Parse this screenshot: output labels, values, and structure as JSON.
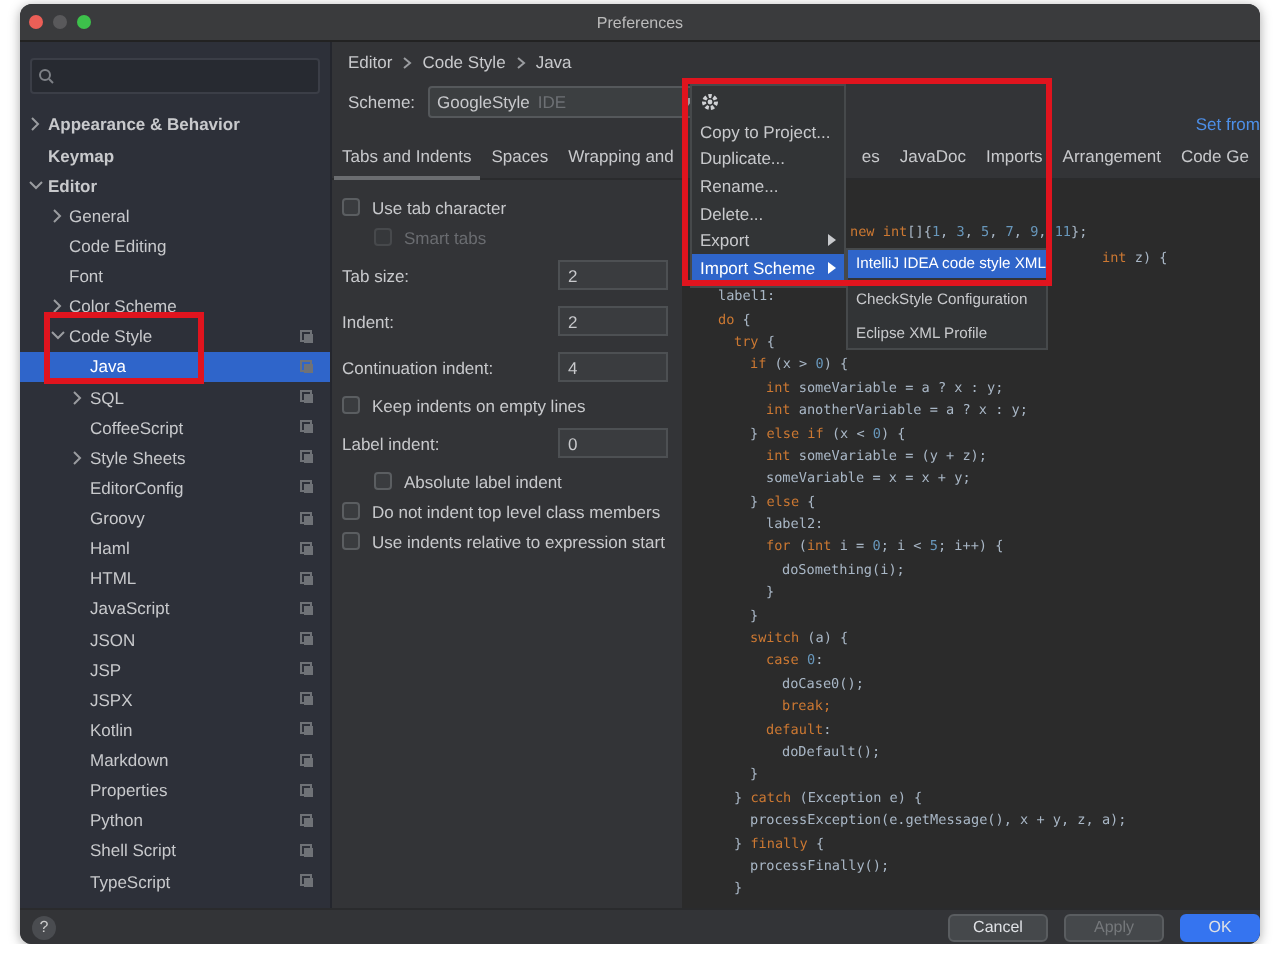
{
  "window": {
    "title": "Preferences"
  },
  "sidebar": {
    "items": [
      {
        "label": "Appearance & Behavior",
        "expanded": false,
        "selected": false,
        "scoped": false
      },
      {
        "label": "Keymap",
        "selected": false,
        "scoped": false
      },
      {
        "label": "Editor",
        "expanded": true,
        "selected": false,
        "scoped": false,
        "children": [
          {
            "label": "General",
            "expanded": false,
            "selected": false,
            "scoped": false
          },
          {
            "label": "Code Editing",
            "selected": false,
            "scoped": false
          },
          {
            "label": "Font",
            "selected": false,
            "scoped": false
          },
          {
            "label": "Color Scheme",
            "expanded": false,
            "selected": false,
            "scoped": false
          },
          {
            "label": "Code Style",
            "expanded": true,
            "selected": false,
            "scoped": true,
            "highlighted": true,
            "children": [
              {
                "label": "Java",
                "selected": true,
                "scoped": true
              },
              {
                "label": "SQL",
                "expanded": false,
                "selected": false,
                "scoped": true
              },
              {
                "label": "CoffeeScript",
                "selected": false,
                "scoped": true
              },
              {
                "label": "Style Sheets",
                "expanded": false,
                "selected": false,
                "scoped": true
              },
              {
                "label": "EditorConfig",
                "selected": false,
                "scoped": true
              },
              {
                "label": "Groovy",
                "selected": false,
                "scoped": true
              },
              {
                "label": "Haml",
                "selected": false,
                "scoped": true
              },
              {
                "label": "HTML",
                "selected": false,
                "scoped": true
              },
              {
                "label": "JavaScript",
                "selected": false,
                "scoped": true
              },
              {
                "label": "JSON",
                "selected": false,
                "scoped": true
              },
              {
                "label": "JSP",
                "selected": false,
                "scoped": true
              },
              {
                "label": "JSPX",
                "selected": false,
                "scoped": true
              },
              {
                "label": "Kotlin",
                "selected": false,
                "scoped": true
              },
              {
                "label": "Markdown",
                "selected": false,
                "scoped": true
              },
              {
                "label": "Properties",
                "selected": false,
                "scoped": true
              },
              {
                "label": "Python",
                "selected": false,
                "scoped": true
              },
              {
                "label": "Shell Script",
                "selected": false,
                "scoped": true
              },
              {
                "label": "TypeScript",
                "selected": false,
                "scoped": true
              }
            ]
          }
        ]
      }
    ]
  },
  "breadcrumb": [
    "Editor",
    "Code Style",
    "Java"
  ],
  "scheme": {
    "label": "Scheme:",
    "value": "GoogleStyle",
    "scope": "IDE"
  },
  "set_from_link": "Set from",
  "tabs": [
    {
      "label": "Tabs and Indents",
      "selected": true
    },
    {
      "label": "Spaces",
      "selected": false
    },
    {
      "label": "Wrapping and",
      "selected": false
    },
    {
      "label": "es",
      "selected": false
    },
    {
      "label": "JavaDoc",
      "selected": false
    },
    {
      "label": "Imports",
      "selected": false
    },
    {
      "label": "Arrangement",
      "selected": false
    },
    {
      "label": "Code Ge",
      "selected": false
    }
  ],
  "options": [
    {
      "kind": "checkbox",
      "label": "Use tab character",
      "checked": false,
      "disabled": false,
      "children": [
        {
          "kind": "checkbox",
          "label": "Smart tabs",
          "checked": false,
          "disabled": true
        }
      ]
    },
    {
      "kind": "number",
      "label": "Tab size:",
      "value": "2"
    },
    {
      "kind": "number",
      "label": "Indent:",
      "value": "2"
    },
    {
      "kind": "number",
      "label": "Continuation indent:",
      "value": "4"
    },
    {
      "kind": "checkbox",
      "label": "Keep indents on empty lines",
      "checked": false,
      "disabled": false
    },
    {
      "kind": "number",
      "label": "Label indent:",
      "value": "0",
      "children": [
        {
          "kind": "checkbox",
          "label": "Absolute label indent",
          "checked": false,
          "disabled": false
        }
      ]
    },
    {
      "kind": "checkbox",
      "label": "Do not indent top level class members",
      "checked": false,
      "disabled": false
    },
    {
      "kind": "checkbox",
      "label": "Use indents relative to expression start",
      "checked": false,
      "disabled": false
    }
  ],
  "code": {
    "covered_lines": [
      {
        "tokens": [
          {
            "kind": "keyword",
            "text": "new "
          },
          {
            "kind": "keyword",
            "text": "int"
          },
          {
            "kind": "plain",
            "text": "[]{"
          },
          {
            "kind": "number",
            "text": "1"
          },
          {
            "kind": "plain",
            "text": ", "
          },
          {
            "kind": "number",
            "text": "3"
          },
          {
            "kind": "plain",
            "text": ", "
          },
          {
            "kind": "number",
            "text": "5"
          },
          {
            "kind": "plain",
            "text": ", "
          },
          {
            "kind": "number",
            "text": "7"
          },
          {
            "kind": "plain",
            "text": ", "
          },
          {
            "kind": "number",
            "text": "9"
          },
          {
            "kind": "plain",
            "text": ", "
          },
          {
            "kind": "number",
            "text": "11"
          },
          {
            "kind": "plain",
            "text": "};"
          }
        ]
      },
      {
        "tokens": [
          {
            "kind": "keyword",
            "text": "int "
          },
          {
            "kind": "plain",
            "text": "z) {"
          }
        ]
      }
    ],
    "lines": [
      {
        "tokens": [
          {
            "kind": "plain",
            "text": "label1:"
          }
        ]
      },
      {
        "tokens": [
          {
            "kind": "keyword",
            "text": "do "
          },
          {
            "kind": "plain",
            "text": "{"
          }
        ],
        "children": [
          {
            "tokens": [
              {
                "kind": "keyword",
                "text": "try "
              },
              {
                "kind": "plain",
                "text": "{"
              }
            ],
            "children": [
              {
                "tokens": [
                  {
                    "kind": "keyword",
                    "text": "if "
                  },
                  {
                    "kind": "plain",
                    "text": "(x > "
                  },
                  {
                    "kind": "number",
                    "text": "0"
                  },
                  {
                    "kind": "plain",
                    "text": ") {"
                  }
                ],
                "children": [
                  {
                    "tokens": [
                      {
                        "kind": "keyword",
                        "text": "int "
                      },
                      {
                        "kind": "plain",
                        "text": "someVariable = a ? x : y;"
                      }
                    ]
                  },
                  {
                    "tokens": [
                      {
                        "kind": "keyword",
                        "text": "int "
                      },
                      {
                        "kind": "plain",
                        "text": "anotherVariable = a ? x : y;"
                      }
                    ]
                  }
                ]
              },
              {
                "tokens": [
                  {
                    "kind": "plain",
                    "text": "} "
                  },
                  {
                    "kind": "keyword",
                    "text": "else if "
                  },
                  {
                    "kind": "plain",
                    "text": "(x < "
                  },
                  {
                    "kind": "number",
                    "text": "0"
                  },
                  {
                    "kind": "plain",
                    "text": ") {"
                  }
                ],
                "children": [
                  {
                    "tokens": [
                      {
                        "kind": "keyword",
                        "text": "int "
                      },
                      {
                        "kind": "plain",
                        "text": "someVariable = (y + z);"
                      }
                    ]
                  },
                  {
                    "tokens": [
                      {
                        "kind": "plain",
                        "text": "someVariable = x = x + y;"
                      }
                    ]
                  }
                ]
              },
              {
                "tokens": [
                  {
                    "kind": "plain",
                    "text": "} "
                  },
                  {
                    "kind": "keyword",
                    "text": "else "
                  },
                  {
                    "kind": "plain",
                    "text": "{"
                  }
                ],
                "children": [
                  {
                    "tokens": [
                      {
                        "kind": "plain",
                        "text": "label2:"
                      }
                    ]
                  },
                  {
                    "tokens": [
                      {
                        "kind": "keyword",
                        "text": "for "
                      },
                      {
                        "kind": "plain",
                        "text": "("
                      },
                      {
                        "kind": "keyword",
                        "text": "int "
                      },
                      {
                        "kind": "plain",
                        "text": "i = "
                      },
                      {
                        "kind": "number",
                        "text": "0"
                      },
                      {
                        "kind": "plain",
                        "text": "; i < "
                      },
                      {
                        "kind": "number",
                        "text": "5"
                      },
                      {
                        "kind": "plain",
                        "text": "; i++) {"
                      }
                    ],
                    "children": [
                      {
                        "tokens": [
                          {
                            "kind": "plain",
                            "text": "doSomething(i);"
                          }
                        ]
                      }
                    ]
                  },
                  {
                    "tokens": [
                      {
                        "kind": "plain",
                        "text": "}"
                      }
                    ]
                  }
                ]
              },
              {
                "tokens": [
                  {
                    "kind": "plain",
                    "text": "}"
                  }
                ]
              },
              {
                "tokens": [
                  {
                    "kind": "keyword",
                    "text": "switch "
                  },
                  {
                    "kind": "plain",
                    "text": "(a) {"
                  }
                ],
                "children": [
                  {
                    "tokens": [
                      {
                        "kind": "keyword",
                        "text": "case "
                      },
                      {
                        "kind": "number",
                        "text": "0"
                      },
                      {
                        "kind": "plain",
                        "text": ":"
                      }
                    ],
                    "children": [
                      {
                        "tokens": [
                          {
                            "kind": "plain",
                            "text": "doCase0();"
                          }
                        ]
                      },
                      {
                        "tokens": [
                          {
                            "kind": "keyword",
                            "text": "break;"
                          }
                        ]
                      }
                    ]
                  },
                  {
                    "tokens": [
                      {
                        "kind": "keyword",
                        "text": "default"
                      },
                      {
                        "kind": "plain",
                        "text": ":"
                      }
                    ],
                    "children": [
                      {
                        "tokens": [
                          {
                            "kind": "plain",
                            "text": "doDefault();"
                          }
                        ]
                      }
                    ]
                  }
                ]
              },
              {
                "tokens": [
                  {
                    "kind": "plain",
                    "text": "}"
                  }
                ]
              }
            ]
          },
          {
            "tokens": [
              {
                "kind": "plain",
                "text": "} "
              },
              {
                "kind": "keyword",
                "text": "catch "
              },
              {
                "kind": "plain",
                "text": "(Exception e) {"
              }
            ],
            "children": [
              {
                "tokens": [
                  {
                    "kind": "plain",
                    "text": "processException(e.getMessage(), x + y, z, a);"
                  }
                ]
              }
            ]
          },
          {
            "tokens": [
              {
                "kind": "plain",
                "text": "} "
              },
              {
                "kind": "keyword",
                "text": "finally "
              },
              {
                "kind": "plain",
                "text": "{"
              }
            ],
            "children": [
              {
                "tokens": [
                  {
                    "kind": "plain",
                    "text": "processFinally();"
                  }
                ]
              }
            ]
          },
          {
            "tokens": [
              {
                "kind": "plain",
                "text": "}"
              }
            ]
          }
        ]
      }
    ]
  },
  "scheme_menu": {
    "highlighted": true,
    "items": [
      {
        "label": "Copy to Project...",
        "submenu": false,
        "selected": false
      },
      {
        "label": "Duplicate...",
        "submenu": false,
        "selected": false
      },
      {
        "label": "Rename...",
        "submenu": false,
        "selected": false
      },
      {
        "label": "Delete...",
        "submenu": false,
        "selected": false
      },
      {
        "label": "Export",
        "submenu": true,
        "selected": false
      },
      {
        "label": "Import Scheme",
        "submenu": true,
        "selected": true
      }
    ],
    "submenu": [
      {
        "label": "IntelliJ IDEA code style XML",
        "selected": true
      },
      {
        "label": "CheckStyle Configuration",
        "selected": false
      },
      {
        "label": "Eclipse XML Profile",
        "selected": false
      }
    ]
  },
  "help": "?",
  "buttons": [
    {
      "label": "Cancel",
      "kind": "normal",
      "disabled": false
    },
    {
      "label": "Apply",
      "kind": "normal",
      "disabled": true
    },
    {
      "label": "OK",
      "kind": "default",
      "disabled": false
    }
  ]
}
